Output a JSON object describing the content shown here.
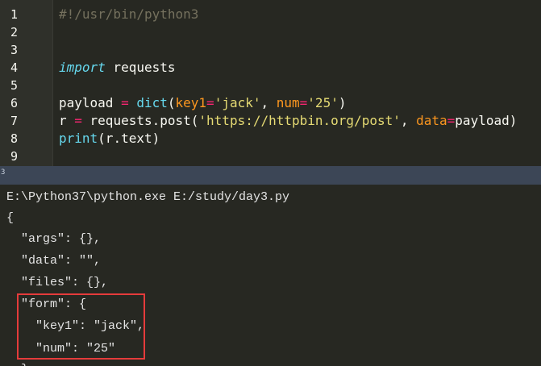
{
  "editor": {
    "line_numbers": [
      "1",
      "2",
      "3",
      "4",
      "5",
      "6",
      "7",
      "8",
      "9"
    ],
    "lines": [
      [
        {
          "t": "#!/usr/bin/python3",
          "c": "tok-comment"
        }
      ],
      [],
      [],
      [
        {
          "t": "import",
          "c": "tok-keyword"
        },
        {
          "t": " requests",
          "c": "tok-plain"
        }
      ],
      [],
      [
        {
          "t": "payload ",
          "c": "tok-plain"
        },
        {
          "t": "=",
          "c": "tok-op"
        },
        {
          "t": " ",
          "c": "tok-plain"
        },
        {
          "t": "dict",
          "c": "tok-builtin"
        },
        {
          "t": "(",
          "c": "tok-plain"
        },
        {
          "t": "key1",
          "c": "tok-param"
        },
        {
          "t": "=",
          "c": "tok-op"
        },
        {
          "t": "'jack'",
          "c": "tok-string"
        },
        {
          "t": ", ",
          "c": "tok-plain"
        },
        {
          "t": "num",
          "c": "tok-param"
        },
        {
          "t": "=",
          "c": "tok-op"
        },
        {
          "t": "'25'",
          "c": "tok-string"
        },
        {
          "t": ")",
          "c": "tok-plain"
        }
      ],
      [
        {
          "t": "r ",
          "c": "tok-plain"
        },
        {
          "t": "=",
          "c": "tok-op"
        },
        {
          "t": " requests.post(",
          "c": "tok-plain"
        },
        {
          "t": "'https://httpbin.org/post'",
          "c": "tok-string"
        },
        {
          "t": ", ",
          "c": "tok-plain"
        },
        {
          "t": "data",
          "c": "tok-param"
        },
        {
          "t": "=",
          "c": "tok-op"
        },
        {
          "t": "payload)",
          "c": "tok-plain"
        }
      ],
      [
        {
          "t": "print",
          "c": "tok-builtin"
        },
        {
          "t": "(r.text)",
          "c": "tok-plain"
        }
      ],
      []
    ]
  },
  "divider": {
    "label": "3"
  },
  "console": {
    "lines": [
      "E:\\Python37\\python.exe E:/study/day3.py",
      "{",
      "  \"args\": {},",
      "  \"data\": \"\",",
      "  \"files\": {},",
      "  \"form\": {",
      "    \"key1\": \"jack\",",
      "    \"num\": \"25\"",
      "  },"
    ]
  },
  "colors": {
    "background": "#272822",
    "gutter": "#2f302a",
    "divider": "#3c4656",
    "highlight": "#e53b3b",
    "comment": "#75715e",
    "keyword": "#66d9ef",
    "operator": "#f92672",
    "parameter": "#fd971f",
    "string": "#e6db74"
  }
}
